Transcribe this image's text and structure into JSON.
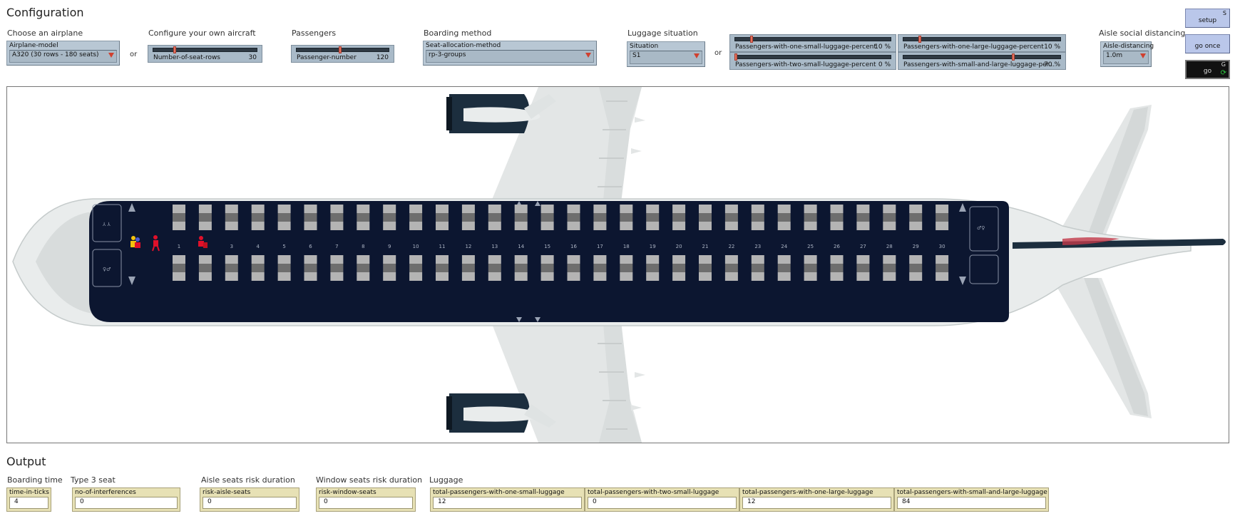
{
  "config": {
    "title": "Configuration",
    "airplane_group": "Choose an airplane",
    "own_aircraft_group": "Configure your own aircraft",
    "passengers_group": "Passengers",
    "boarding_group": "Boarding method",
    "luggage_group": "Luggage situation",
    "social_group": "Aisle social distancing",
    "or_1": "or",
    "or_2": "or",
    "airplane_model": {
      "name": "Airplane-model",
      "value": "A320 (30 rows - 180 seats)"
    },
    "seat_rows": {
      "name": "Number-of-seat-rows",
      "value": "30",
      "level": 0.2
    },
    "passenger_number": {
      "name": "Passenger-number",
      "value": "120",
      "level": 0.47
    },
    "seat_allocation": {
      "name": "Seat-allocation-method",
      "value": "rp-3-groups"
    },
    "situation": {
      "name": "Situation",
      "value": "S1"
    },
    "luggage_sliders": [
      {
        "name": "Passengers-with-one-small-luggage-percent",
        "value": "10 %",
        "level": 0.1
      },
      {
        "name": "Passengers-with-one-large-luggage-percent",
        "value": "10 %",
        "level": 0.1
      },
      {
        "name": "Passengers-with-two-small-luggage-percent",
        "value": "0 %",
        "level": 0.0
      },
      {
        "name": "Passengers-with-small-and-large-luggage-per...",
        "value": "70 %",
        "level": 0.7
      }
    ],
    "aisle_distancing": {
      "name": "Aisle-distancing",
      "value": "1.0m"
    }
  },
  "buttons": {
    "setup": {
      "label": "setup",
      "key": "S"
    },
    "go_once": {
      "label": "go once"
    },
    "go": {
      "label": "go",
      "key": "G"
    }
  },
  "plane": {
    "rows": [
      "1",
      "2",
      "3",
      "4",
      "5",
      "6",
      "7",
      "8",
      "9",
      "10",
      "11",
      "12",
      "13",
      "14",
      "15",
      "16",
      "17",
      "18",
      "19",
      "20",
      "21",
      "22",
      "23",
      "24",
      "25",
      "26",
      "27",
      "28",
      "29",
      "30"
    ],
    "exit_label": "EXIT",
    "colors": {
      "cabin": "#0c1630",
      "seat_light": "#b4b4b4",
      "seat_dark": "#6e6e6e",
      "fuselage": "#e9ecec",
      "engine": "#1c2e3e",
      "passenger_red": "#e0102a"
    }
  },
  "output": {
    "title": "Output",
    "boarding_group": "Boarding time",
    "type3_group": "Type 3 seat",
    "aisle_group": "Aisle seats risk duration",
    "window_group": "Window seats risk duration",
    "luggage_group": "Luggage",
    "monitors": {
      "time": {
        "name": "time-in-ticks",
        "value": "4"
      },
      "interferences": {
        "name": "no-of-interferences",
        "value": "0"
      },
      "aisle": {
        "name": "risk-aisle-seats",
        "value": "0"
      },
      "window": {
        "name": "risk-window-seats",
        "value": "0"
      },
      "one_small": {
        "name": "total-passengers-with-one-small-luggage",
        "value": "12"
      },
      "two_small": {
        "name": "total-passengers-with-two-small-luggage",
        "value": "0"
      },
      "one_large": {
        "name": "total-passengers-with-one-large-luggage",
        "value": "12"
      },
      "small_large": {
        "name": "total-passengers-with-small-and-large-luggage",
        "value": "84"
      }
    }
  }
}
